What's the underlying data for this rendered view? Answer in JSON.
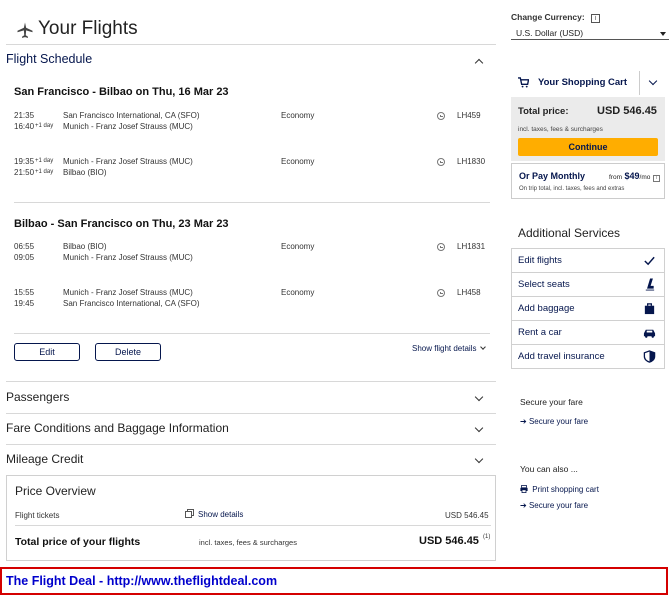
{
  "header": {
    "title": "Your Flights",
    "icon": "airplane-icon"
  },
  "schedule": {
    "section_title": "Flight Schedule",
    "outbound": {
      "title": "San Francisco - Bilbao on Thu, 16 Mar 23",
      "segments": [
        {
          "dep_time": "21:35",
          "arr_time": "16:40",
          "arr_day": "+1 day",
          "from": "San Francisco International, CA (SFO)",
          "to": "Munich - Franz Josef Strauss (MUC)",
          "cabin": "Economy",
          "flight": "LH459"
        },
        {
          "dep_time": "19:35",
          "dep_day": "+1 day",
          "arr_time": "21:50",
          "arr_day": "+1 day",
          "from": "Munich - Franz Josef Strauss (MUC)",
          "to": "Bilbao (BIO)",
          "cabin": "Economy",
          "flight": "LH1830"
        }
      ]
    },
    "inbound": {
      "title": "Bilbao - San Francisco on Thu, 23 Mar 23",
      "segments": [
        {
          "dep_time": "06:55",
          "arr_time": "09:05",
          "from": "Bilbao (BIO)",
          "to": "Munich - Franz Josef Strauss (MUC)",
          "cabin": "Economy",
          "flight": "LH1831"
        },
        {
          "dep_time": "15:55",
          "arr_time": "19:45",
          "from": "Munich - Franz Josef Strauss (MUC)",
          "to": "San Francisco International, CA (SFO)",
          "cabin": "Economy",
          "flight": "LH458"
        }
      ]
    },
    "edit_label": "Edit",
    "delete_label": "Delete",
    "show_details_label": "Show flight details"
  },
  "accordions": {
    "passengers": "Passengers",
    "fare_conditions": "Fare Conditions and Baggage Information",
    "mileage": "Mileage Credit"
  },
  "price_overview": {
    "title": "Price Overview",
    "tickets_label": "Flight tickets",
    "show_details": "Show details",
    "tickets_price": "USD 546.45",
    "total_label": "Total price of your flights",
    "total_note": "incl. taxes, fees & surcharges",
    "total_price": "USD 546.45",
    "total_footnote": "(1)"
  },
  "banner": {
    "text": "The Flight Deal - http://www.theflightdeal.com"
  },
  "sidebar": {
    "currency_label": "Change Currency:",
    "currency_info": "i",
    "currency_value": "U.S. Dollar (USD)",
    "cart_title": "Your Shopping Cart",
    "total_label": "Total price:",
    "total_value": "USD 546.45",
    "total_note": "incl. taxes, fees & surcharges",
    "continue_label": "Continue",
    "monthly_title": "Or Pay Monthly",
    "monthly_from": "from",
    "monthly_amount": "$49",
    "monthly_unit": "/mo",
    "monthly_info": "i",
    "monthly_note": "On trip total, incl. taxes, fees and extras",
    "services_title": "Additional Services",
    "services": [
      {
        "label": "Edit flights",
        "icon": "checkmark-icon"
      },
      {
        "label": "Select seats",
        "icon": "seat-icon"
      },
      {
        "label": "Add baggage",
        "icon": "suitcase-icon"
      },
      {
        "label": "Rent a car",
        "icon": "car-icon"
      },
      {
        "label": "Add travel insurance",
        "icon": "shield-icon"
      }
    ],
    "secure_title": "Secure your fare",
    "secure_link": "Secure your fare",
    "also_title": "You can also ...",
    "print_link": "Print shopping cart",
    "secure_link2": "Secure your fare"
  },
  "colors": {
    "brand_navy": "#05164d",
    "accent_yellow": "#ffad00",
    "banner_red": "#d40000",
    "banner_text": "#0000cc"
  }
}
